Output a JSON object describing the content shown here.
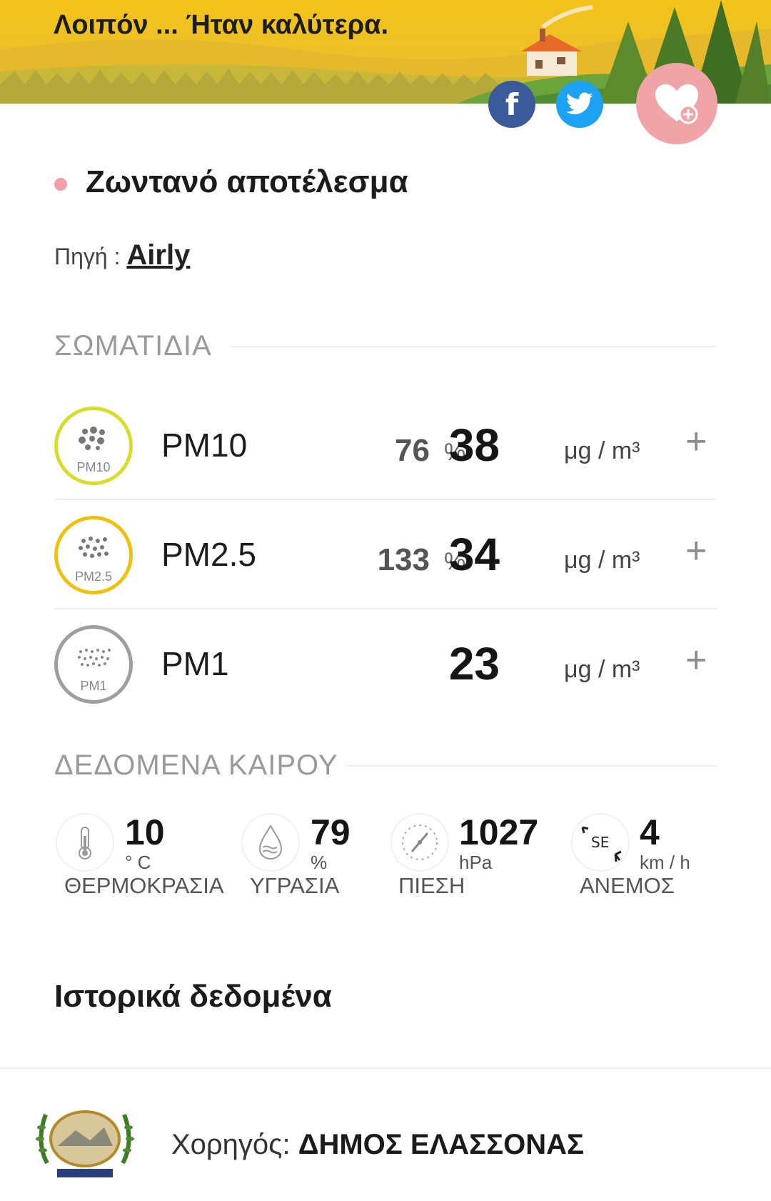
{
  "banner": {
    "title": "Λοιπόν ... Ήταν καλύτερα."
  },
  "share": {
    "facebook_glyph": "f"
  },
  "live": {
    "title": "Ζωντανό αποτέλεσμα",
    "source_label": "Πηγή :",
    "source_link": "Airly"
  },
  "particles": {
    "heading": "ΣΩΜΑΤΙΔΙΑ",
    "rows": [
      {
        "name": "PM10",
        "icon_caption": "PM10",
        "percent": "76",
        "percent_sign": "%",
        "value": "38",
        "unit": "μg / m³",
        "color": "#d8dc2a"
      },
      {
        "name": "PM2.5",
        "icon_caption": "PM2.5",
        "percent": "133",
        "percent_sign": "%",
        "value": "34",
        "unit": "μg / m³",
        "color": "#f0c010"
      },
      {
        "name": "PM1",
        "icon_caption": "PM1",
        "percent": "",
        "percent_sign": "",
        "value": "23",
        "unit": "μg / m³",
        "color": "#9e9e9e"
      }
    ],
    "expand_glyph": "+"
  },
  "weather": {
    "heading": "ΔΕΔΟΜΕΝΑ ΚΑΙΡΟΥ",
    "items": [
      {
        "value": "10",
        "unit": "° C",
        "label": "ΘΕΡΜΟΚΡΑΣΙΑ",
        "icon": "thermometer-icon"
      },
      {
        "value": "79",
        "unit": "%",
        "label": "ΥΓΡΑΣΙΑ",
        "icon": "humidity-icon"
      },
      {
        "value": "1027",
        "unit": "hPa",
        "label": "ΠΙΕΣΗ",
        "icon": "pressure-gauge-icon"
      },
      {
        "value": "4",
        "unit": "km / h",
        "label": "ΑΝΕΜΟΣ",
        "icon": "wind-direction-icon",
        "direction": "SE"
      }
    ]
  },
  "history": {
    "title": "Ιστορικά δεδομένα"
  },
  "footer": {
    "sponsor_label": "Χορηγός:",
    "sponsor_name": "ΔΗΜΟΣ ΕΛΑΣΣΟΝΑΣ"
  }
}
